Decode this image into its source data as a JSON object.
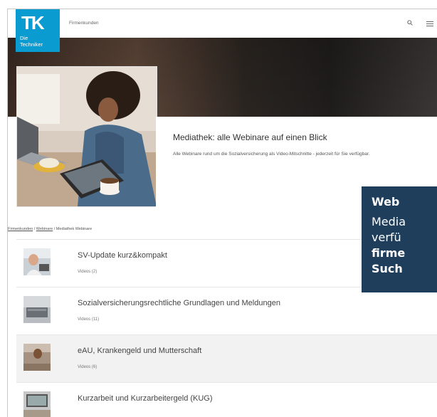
{
  "header": {
    "logo_main": "TK",
    "logo_line1": "Die",
    "logo_line2": "Techniker",
    "nav_label": "Firmenkunden",
    "search_icon": "search-icon",
    "menu_icon": "hamburger-menu-icon"
  },
  "hero": {
    "title": "Mediathek: alle Webinare auf einen Blick",
    "description": "Alle Webinare rund um die Sozialversicherung als Video-Mitschnitte - jederzeit für Sie verfügbar."
  },
  "breadcrumb": {
    "items": [
      "Firmenkunden",
      "Webinare",
      "Mediathek Webinare"
    ],
    "separator": " / "
  },
  "list": [
    {
      "title": "SV-Update kurz&kompakt",
      "subtitle": "Videos (2)"
    },
    {
      "title": "Sozialversicherungsrechtliche Grundlagen und Meldungen",
      "subtitle": "Videos (11)"
    },
    {
      "title": "eAU, Krankengeld und Mutterschaft",
      "subtitle": "Videos (6)"
    },
    {
      "title": "Kurzarbeit und Kurzarbeitergeld (KUG)",
      "subtitle": ""
    }
  ],
  "overlay": {
    "line1": "Web",
    "line2": "Media",
    "line3": "verfü",
    "line4": "firme",
    "line5": "Such"
  },
  "colors": {
    "brand": "#0a9bd1",
    "overlay_bg": "#1f3e5c"
  }
}
